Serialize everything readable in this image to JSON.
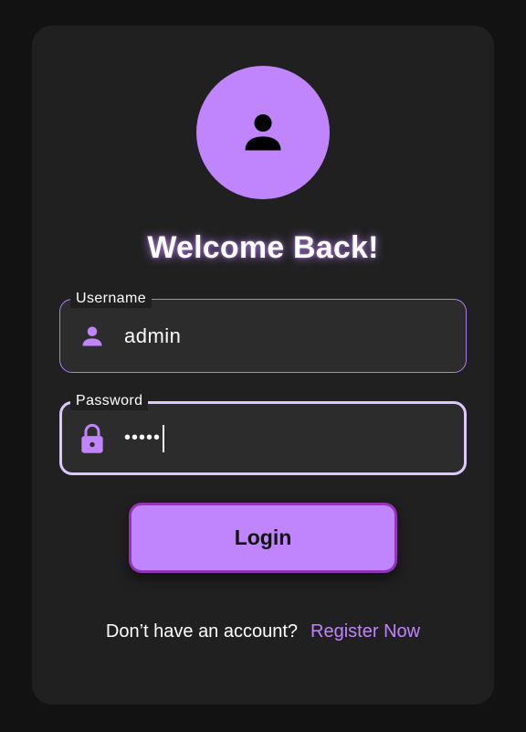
{
  "header": {
    "title": "Welcome Back!",
    "avatar_icon": "person-icon"
  },
  "form": {
    "username": {
      "label": "Username",
      "value": "admin",
      "icon": "person-icon"
    },
    "password": {
      "label": "Password",
      "value": "•••••",
      "icon": "lock-icon"
    },
    "login_label": "Login"
  },
  "footer": {
    "prompt": "Don’t have an account?",
    "register_label": "Register Now"
  },
  "colors": {
    "accent": "#c084fc",
    "background": "#121212",
    "card": "#202020",
    "field": "#2c2c2c"
  }
}
